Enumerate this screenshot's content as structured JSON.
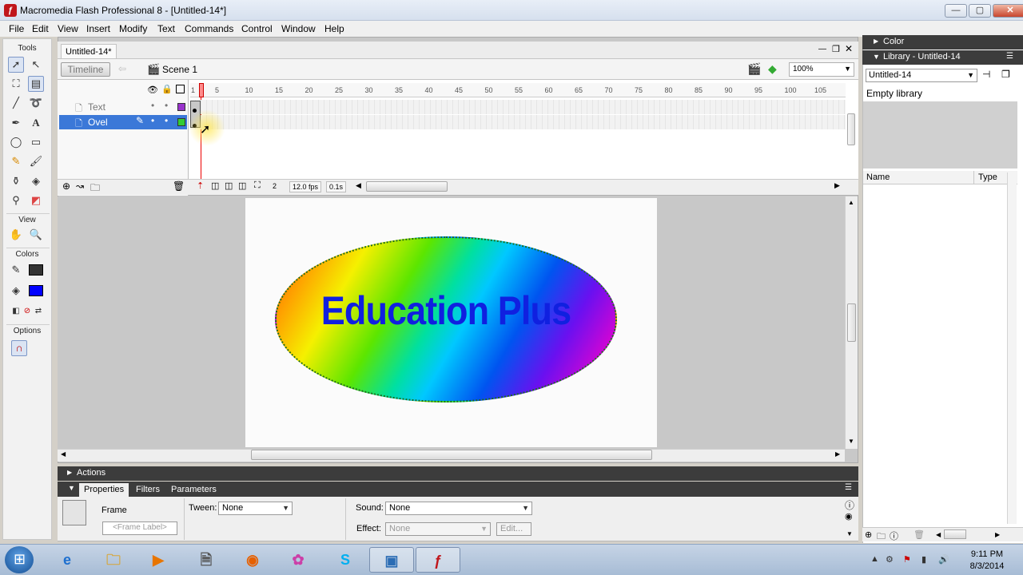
{
  "window": {
    "title": "Macromedia Flash Professional 8 - [Untitled-14*]",
    "icon": "flash-app-icon",
    "controls": [
      "—",
      "▢",
      "✕"
    ]
  },
  "menubar": [
    "File",
    "Edit",
    "View",
    "Insert",
    "Modify",
    "Text",
    "Commands",
    "Control",
    "Window",
    "Help"
  ],
  "tools": {
    "header": "Tools",
    "view_header": "View",
    "colors_header": "Colors",
    "options_header": "Options",
    "stroke_color": "#333333",
    "fill_color": "#0000ff"
  },
  "document": {
    "tab": "Untitled-14*",
    "timeline_button": "Timeline",
    "scene": "Scene 1",
    "zoom": "100%"
  },
  "timeline": {
    "ruler": [
      "1",
      "5",
      "10",
      "15",
      "20",
      "25",
      "30",
      "35",
      "40",
      "45",
      "50",
      "55",
      "60",
      "65",
      "70",
      "75",
      "80",
      "85",
      "90",
      "95",
      "100",
      "105"
    ],
    "layers": [
      {
        "name": "Text",
        "selected": false,
        "color": "#9933cc"
      },
      {
        "name": "Ovel",
        "selected": true,
        "color": "#33cc33"
      }
    ],
    "current_frame": "2",
    "fps": "12.0 fps",
    "time": "0.1s"
  },
  "stage": {
    "text": "Education Plus"
  },
  "panels": {
    "actions": "Actions",
    "properties_tabs": [
      "Properties",
      "Filters",
      "Parameters"
    ],
    "frame_label": "Frame",
    "frame_label_placeholder": "<Frame Label>",
    "tween_label": "Tween:",
    "tween_value": "None",
    "sound_label": "Sound:",
    "sound_value": "None",
    "effect_label": "Effect:",
    "effect_value": "None",
    "edit_button": "Edit..."
  },
  "right": {
    "color_panel": "Color",
    "library_panel": "Library - Untitled-14",
    "library_select": "Untitled-14",
    "empty_text": "Empty library",
    "col_name": "Name",
    "col_type": "Type"
  },
  "taskbar": {
    "time": "9:11 PM",
    "date": "8/3/2014"
  }
}
